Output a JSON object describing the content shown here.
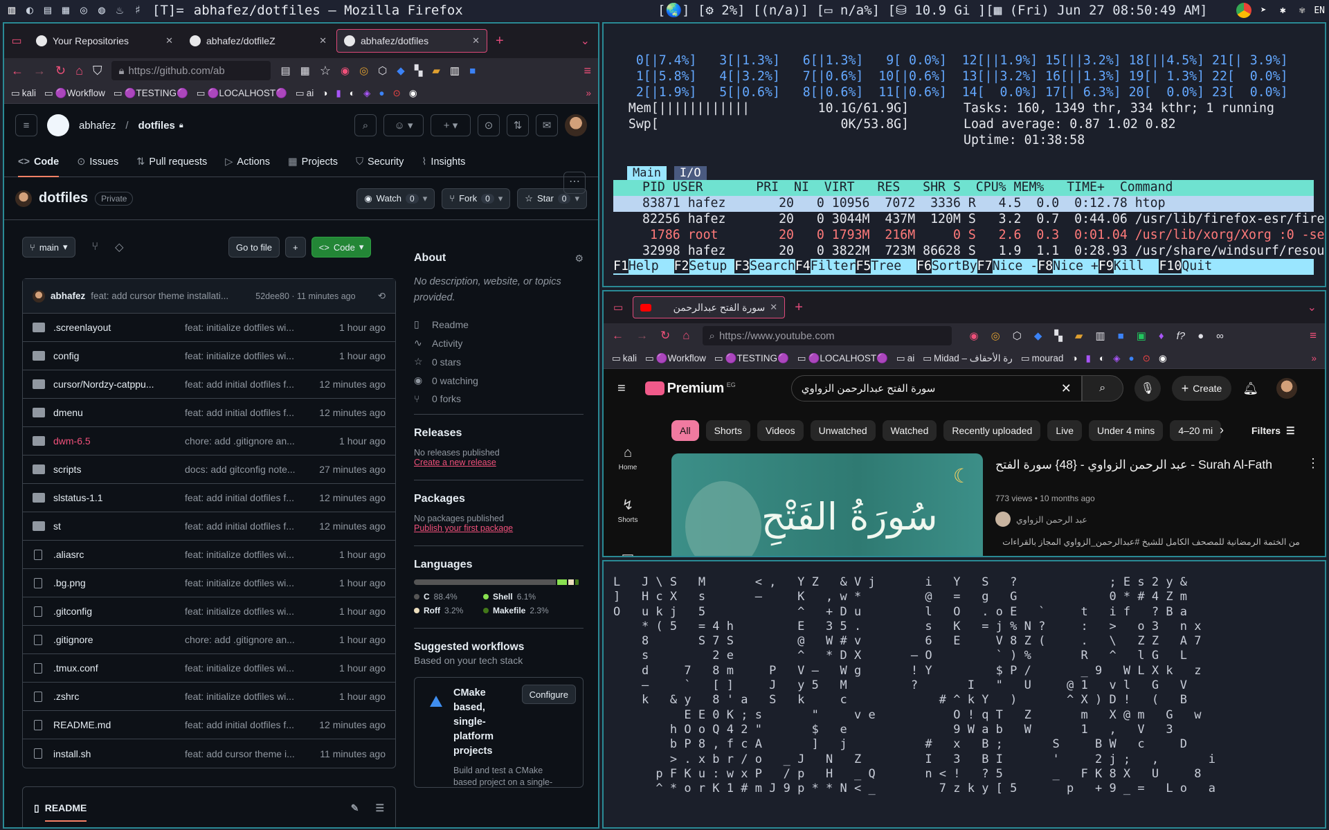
{
  "topbar": {
    "tags": [
      "▥",
      "◐",
      "▤",
      "▦",
      "◎",
      "◍",
      "♨",
      "♯"
    ],
    "layout": "[T]=",
    "window_title": "abhafez/dotfiles — Mozilla Firefox",
    "status": "[🌏] [⚙ 2%] [(n/a)] [▭ n/a%] [⛁ 10.9 Gi ][▦ (Fri) Jun 27 08:50:49 AM]",
    "tray": [
      "chrome",
      "telegram",
      "slack",
      "pinwheel",
      "EN"
    ]
  },
  "firefox": {
    "tabs": [
      {
        "label": "Your Repositories",
        "active": false
      },
      {
        "label": "abhafez/dotfileZ",
        "active": false
      },
      {
        "label": "abhafez/dotfiles",
        "active": true
      }
    ],
    "url": "https://github.com/ab",
    "bookmarks": [
      "kali",
      "🟣Workflow",
      "🟣TESTING🟣",
      "🟣LOCALHOST🟣",
      "ai"
    ],
    "github": {
      "owner": "abhafez",
      "repo": "dotfiles",
      "repo_tabs": [
        "Code",
        "Issues",
        "Pull requests",
        "Actions",
        "Projects",
        "Security",
        "Insights"
      ],
      "visibility": "Private",
      "watch": {
        "label": "Watch",
        "count": "0"
      },
      "fork": {
        "label": "Fork",
        "count": "0"
      },
      "star": {
        "label": "Star",
        "count": "0"
      },
      "branch": "main",
      "goto_file": "Go to file",
      "code_btn": "Code",
      "last_commit": {
        "author": "abhafez",
        "message": "feat: add cursor theme installati...",
        "hash_time": "52dee80 · 11 minutes ago"
      },
      "files": [
        {
          "name": ".screenlayout",
          "type": "dir",
          "msg": "feat: initialize dotfiles wi...",
          "time": "1 hour ago"
        },
        {
          "name": "config",
          "type": "dir",
          "msg": "feat: initialize dotfiles wi...",
          "time": "1 hour ago"
        },
        {
          "name": "cursor/Nordzy-catppu...",
          "type": "dir",
          "msg": "feat: add initial dotfiles f...",
          "time": "12 minutes ago"
        },
        {
          "name": "dmenu",
          "type": "dir",
          "msg": "feat: add initial dotfiles f...",
          "time": "12 minutes ago"
        },
        {
          "name": "dwm-6.5",
          "type": "sub",
          "msg": "chore: add .gitignore an...",
          "time": "1 hour ago"
        },
        {
          "name": "scripts",
          "type": "dir",
          "msg": "docs: add gitconfig note...",
          "time": "27 minutes ago"
        },
        {
          "name": "slstatus-1.1",
          "type": "dir",
          "msg": "feat: add initial dotfiles f...",
          "time": "12 minutes ago"
        },
        {
          "name": "st",
          "type": "dir",
          "msg": "feat: add initial dotfiles f...",
          "time": "12 minutes ago"
        },
        {
          "name": ".aliasrc",
          "type": "file",
          "msg": "feat: initialize dotfiles wi...",
          "time": "1 hour ago"
        },
        {
          "name": ".bg.png",
          "type": "file",
          "msg": "feat: initialize dotfiles wi...",
          "time": "1 hour ago"
        },
        {
          "name": ".gitconfig",
          "type": "file",
          "msg": "feat: initialize dotfiles wi...",
          "time": "1 hour ago"
        },
        {
          "name": ".gitignore",
          "type": "file",
          "msg": "chore: add .gitignore an...",
          "time": "1 hour ago"
        },
        {
          "name": ".tmux.conf",
          "type": "file",
          "msg": "feat: initialize dotfiles wi...",
          "time": "1 hour ago"
        },
        {
          "name": ".zshrc",
          "type": "file",
          "msg": "feat: initialize dotfiles wi...",
          "time": "1 hour ago"
        },
        {
          "name": "README.md",
          "type": "file",
          "msg": "feat: add initial dotfiles f...",
          "time": "12 minutes ago"
        },
        {
          "name": "install.sh",
          "type": "file",
          "msg": "feat: add cursor theme i...",
          "time": "11 minutes ago"
        }
      ],
      "readme_label": "README",
      "about": {
        "title": "About",
        "desc": "No description, website, or topics provided.",
        "items": [
          "Readme",
          "Activity",
          "0 stars",
          "0 watching",
          "0 forks"
        ]
      },
      "releases": {
        "title": "Releases",
        "text": "No releases published",
        "link": "Create a new release"
      },
      "packages": {
        "title": "Packages",
        "text": "No packages published",
        "link": "Publish your first package"
      },
      "languages": {
        "title": "Languages",
        "items": [
          {
            "name": "C",
            "pct": "88.4%",
            "value": 88.4,
            "color": "#555555"
          },
          {
            "name": "Shell",
            "pct": "6.1%",
            "value": 6.1,
            "color": "#89e051"
          },
          {
            "name": "Roff",
            "pct": "3.2%",
            "value": 3.2,
            "color": "#ecdebe"
          },
          {
            "name": "Makefile",
            "pct": "2.3%",
            "value": 2.3,
            "color": "#427819"
          }
        ]
      },
      "workflows": {
        "title": "Suggested workflows",
        "subtitle": "Based on your tech stack",
        "card_title": "CMake based, single-platform projects",
        "card_desc": "Build and test a CMake based project on a single-",
        "configure": "Configure"
      }
    }
  },
  "htop": {
    "cpu_lines": [
      "   0[|7.4%]   3[|1.3%]   6[|1.3%]   9[ 0.0%]  12[||1.9%] 15[||3.2%] 18[||4.5%] 21[| 3.9%]",
      "   1[|5.8%]   4[|3.2%]   7[|0.6%]  10[|0.6%]  13[||3.2%] 16[||1.3%] 19[| 1.3%] 22[  0.0%]",
      "   2[|1.9%]   5[|0.6%]   8[|0.6%]  11[|0.6%]  14[  0.0%] 17[| 6.3%] 20[  0.0%] 23[  0.0%]"
    ],
    "mem": "  Mem[||||||||||||         10.1G/61.9G]",
    "swp": "  Swp[                        0K/53.8G]",
    "tasks": "Tasks: 160, 1349 thr, 334 kthr; 1 running",
    "load": "Load average: 0.87 1.02 0.82",
    "uptime": "Uptime: 01:38:58",
    "tab_main": "Main",
    "tab_io": "I/O",
    "header": "PID USER       PRI  NI  VIRT   RES   SHR S  CPU% MEM%   TIME+  Command",
    "rows": [
      "83871 hafez       20   0 10956  7072  3336 R   4.5  0.0  0:12.78 htop",
      "82256 hafez       20   0 3044M  437M  120M S   3.2  0.7  0:44.06 /usr/lib/firefox-esr/fire",
      " 1786 root        20   0 1793M  216M     0 S   2.6  0.3  0:01.04 /usr/lib/xorg/Xorg :0 -se",
      "32998 hafez       20   0 3822M  723M 86628 S   1.9  1.1  0:28.93 /usr/share/windsurf/resou"
    ],
    "fkeys": [
      [
        "F1",
        "Help  "
      ],
      [
        "F2",
        "Setup "
      ],
      [
        "F3",
        "Search"
      ],
      [
        "F4",
        "Filter"
      ],
      [
        "F5",
        "Tree  "
      ],
      [
        "F6",
        "SortBy"
      ],
      [
        "F7",
        "Nice -"
      ],
      [
        "F8",
        "Nice +"
      ],
      [
        "F9",
        "Kill  "
      ],
      [
        "F10",
        "Quit"
      ]
    ]
  },
  "youtube": {
    "tab": "سورة الفتح  عبدالرحمن",
    "url": "https://www.youtube.com",
    "bookmarks": [
      "kali",
      "🟣Workflow",
      "🟣TESTING🟣",
      "🟣LOCALHOST🟣",
      "ai",
      "Midad – رة الأحقاف",
      "mourad"
    ],
    "logo": "Premium",
    "region": "EG",
    "search": "سورة الفتح عبدالرحمن الزواوي",
    "create": "Create",
    "chips": [
      "All",
      "Shorts",
      "Videos",
      "Unwatched",
      "Watched",
      "Recently uploaded",
      "Live",
      "Under 4 mins",
      "4–20 mi"
    ],
    "filters": "Filters",
    "side": [
      "Home",
      "Shorts",
      "Subscriptions"
    ],
    "video": {
      "title": "عبد الرحمن الزواوي - {48} سورة الفتح - Surah Al-Fath",
      "meta": "773 views • 10 months ago",
      "channel": "عبد الرحمن الزواوي",
      "desc": "من الختمة الرمضانية للمصحف الكامل للشيخ #عبدالرحمن_الزواوي المجاز بالقراءات",
      "thumb_text": "سُورَةُ الفَتْحِ"
    }
  },
  "matrix": {
    "lines": [
      "L   J \\ S   M       < ,   Y Z   & V j       i   Y   S   ?             ; E s 2 y &",
      "]   H c X   s       –     K   , w *         @   =   g   G             0 * # 4 Z m",
      "O   u k j   5             ^   + D u         l   O   . o E   `     t   i f   ? B a",
      "    * ( 5   = 4 h         E   3 5 .         s   K   = j % N ?     :   >   o 3   n x",
      "    8       S 7 S         @   W # v         6   E     V 8 Z (     .   \\   Z Z   A 7",
      "    s         2 e         ^   * D X       – O         ` ) %       R   ^   l G   L",
      "    d     7   8 m     P   V –   W g       ! Y         $ P /       _ 9   W L X k   z",
      "    –     `   [ ]     J   y 5   M         ?       I   \"   U     @ 1   v l   G   V",
      "    k   & y   8 ' a   S   k     c             # ^ k Y   )       ^ X ) D !   (   B",
      "          E E 0 K ; s       \"     v e           O ! q T   Z       m   X @ m   G   w",
      "        h O o Q 4 2 \"       $   e               9 W a b   W       1   ,   V   3",
      "        b P 8 , f c A       ]   j           #   x   B ;       S     B W   c     D",
      "        > . x b r / o   _ J   N   Z         I   3   B I       '     2 j ;   ,       i",
      "      p F K u : w x P   / p   H   _ Q       n < !   ? 5       _   F K 8 X   U     8",
      "      ^ * o r K 1 # m J 9 p * * N < _         7 z k y [ 5       p   + 9 _ =   L o   a"
    ]
  }
}
